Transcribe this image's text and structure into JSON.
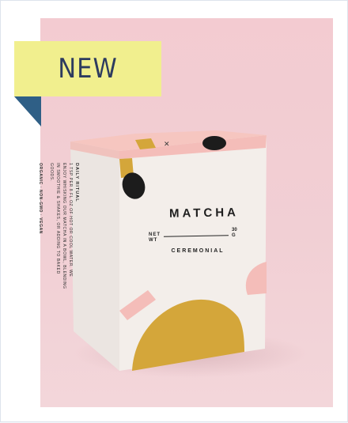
{
  "badge": {
    "label": "NEW",
    "background_color": "#f1ef8e",
    "text_color": "#2d3b5f",
    "fold_color": "#2f5f86"
  },
  "product": {
    "name": "MATCHA",
    "net_weight_label": "NET\nWT",
    "net_weight_value": "30\nG",
    "grade": "CEREMONIAL",
    "side_panel": {
      "heading": "DAILY RITUAL",
      "body": "1 TSP PER 8 FL OZ OF HOT OR COOL WATER. WE ENJOY WHISKING OUR MATCHA IN A BOWL, BLENDING IN SMOOTHIE & SHAKES, OR ADDING TO BAKED GOODS.",
      "footer": "ORGANIC · NON-GMO · VEGAN"
    }
  },
  "colors": {
    "background": "#f3cbd1",
    "box_face": "#f1ece8",
    "box_side": "#e7e0dc",
    "box_lid_pink": "#f4bdb9",
    "mustard": "#d4a63a",
    "black": "#1c1c1c"
  }
}
